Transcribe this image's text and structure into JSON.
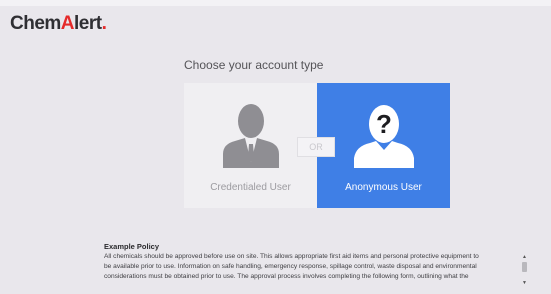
{
  "brand": {
    "logo_parts": [
      "Chem",
      "A",
      "lert",
      "."
    ],
    "colors": {
      "dark": "#2f2f33",
      "accent": "#e52a2a"
    }
  },
  "account_select": {
    "heading": "Choose your account type",
    "separator": "OR",
    "options": [
      {
        "label": "Credentialed User",
        "icon": "user-silhouette-icon",
        "selected": false,
        "background": "#f0eff2"
      },
      {
        "label": "Anonymous User",
        "icon": "anonymous-user-icon",
        "selected": true,
        "background": "#3f7fe6"
      }
    ]
  },
  "policy": {
    "title": "Example Policy",
    "lines": [
      "All chemicals should be approved before use on site. This allows appropriate first aid items and personal protective equipment to",
      "be available prior to use. Information on safe handling, emergency response, spillage control, waste disposal and environmental",
      "considerations must be obtained prior to use. The approval process involves completing the following form, outlining what the"
    ]
  }
}
